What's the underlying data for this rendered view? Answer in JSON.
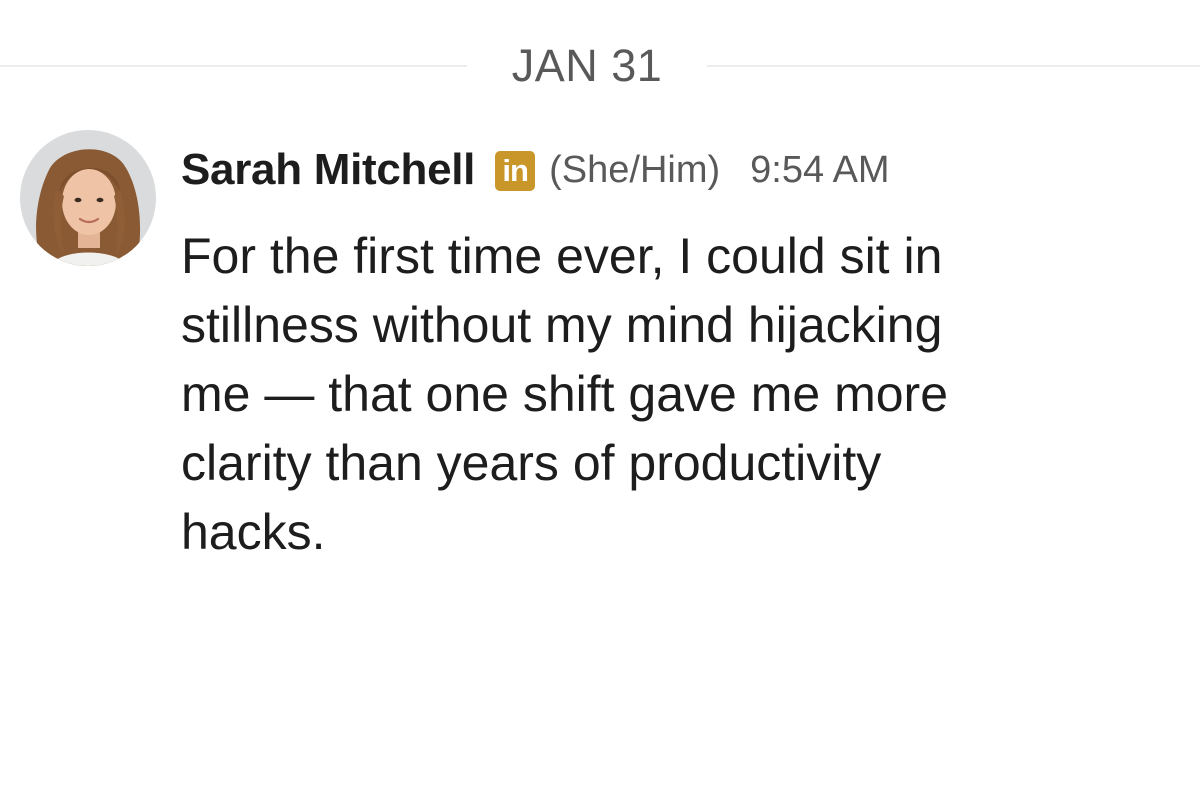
{
  "divider": {
    "date": "JAN 31"
  },
  "message": {
    "sender": "Sarah Mitchell",
    "badge": {
      "label": "in",
      "icon": "linkedin-icon",
      "color": "#c9962a"
    },
    "pronouns": "(She/Him)",
    "time": "9:54 AM",
    "lines": [
      "For the first time ever, I could sit in",
      "stillness without my mind hijacking",
      "me — that one shift gave me more",
      "clarity than years of productivity",
      "hacks."
    ]
  }
}
